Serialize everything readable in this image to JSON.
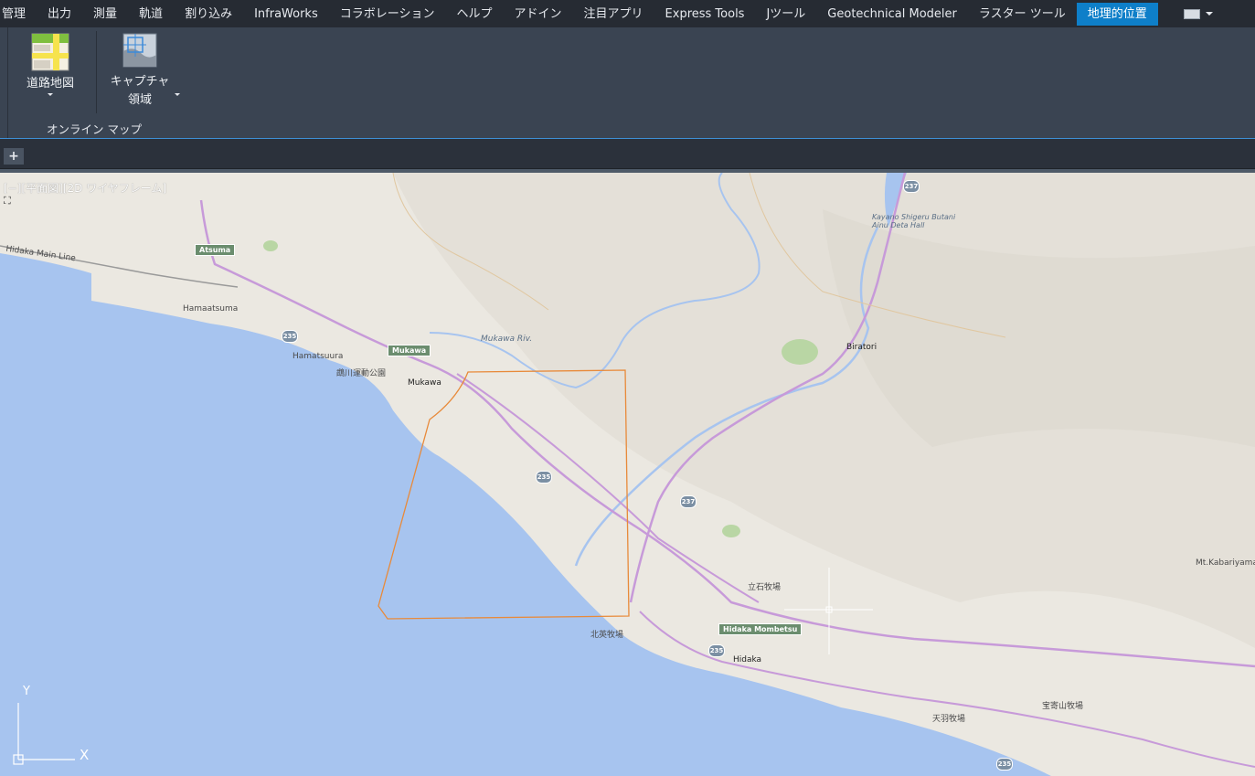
{
  "tabs": [
    {
      "label": "管理",
      "active": false
    },
    {
      "label": "出力",
      "active": false
    },
    {
      "label": "測量",
      "active": false
    },
    {
      "label": "軌道",
      "active": false
    },
    {
      "label": "割り込み",
      "active": false
    },
    {
      "label": "InfraWorks",
      "active": false
    },
    {
      "label": "コラボレーション",
      "active": false
    },
    {
      "label": "ヘルプ",
      "active": false
    },
    {
      "label": "アドイン",
      "active": false
    },
    {
      "label": "注目アプリ",
      "active": false
    },
    {
      "label": "Express Tools",
      "active": false
    },
    {
      "label": "Jツール",
      "active": false
    },
    {
      "label": "Geotechnical Modeler",
      "active": false
    },
    {
      "label": "ラスター ツール",
      "active": false
    },
    {
      "label": "地理的位置",
      "active": true
    }
  ],
  "ribbon": {
    "road_map_label": "道路地図",
    "capture_label_line1": "キャプチャ",
    "capture_label_line2": "領域",
    "panel_title": "オンライン マップ"
  },
  "file_tab_add": "+",
  "viewport": {
    "view_label": "[−][平面図][2D ワイヤフレーム]",
    "ucs_y": "Y",
    "ucs_x": "X"
  },
  "map": {
    "stations": [
      "Atsuma",
      "Mukawa",
      "Hidaka Mombetsu"
    ],
    "places": [
      "Hidaka Main Line",
      "Hamaatsuma",
      "Hamatsuura",
      "鵡川運動公園",
      "Mukawa",
      "Mukawa Riv.",
      "Biratori",
      "Kayano Shigeru Butani Ainu Deta Hall",
      "立石牧場",
      "北英牧場",
      "Hidaka",
      "Mt.Kabariyama",
      "天羽牧場",
      "宝寄山牧場"
    ],
    "route_numbers": [
      "235",
      "237"
    ]
  },
  "colors": {
    "accent": "#0e7fc9",
    "sea": "#a7c4ef",
    "land": "#ebe8e1",
    "road": "#c79ad9",
    "capture_outline": "#e88a3a"
  }
}
